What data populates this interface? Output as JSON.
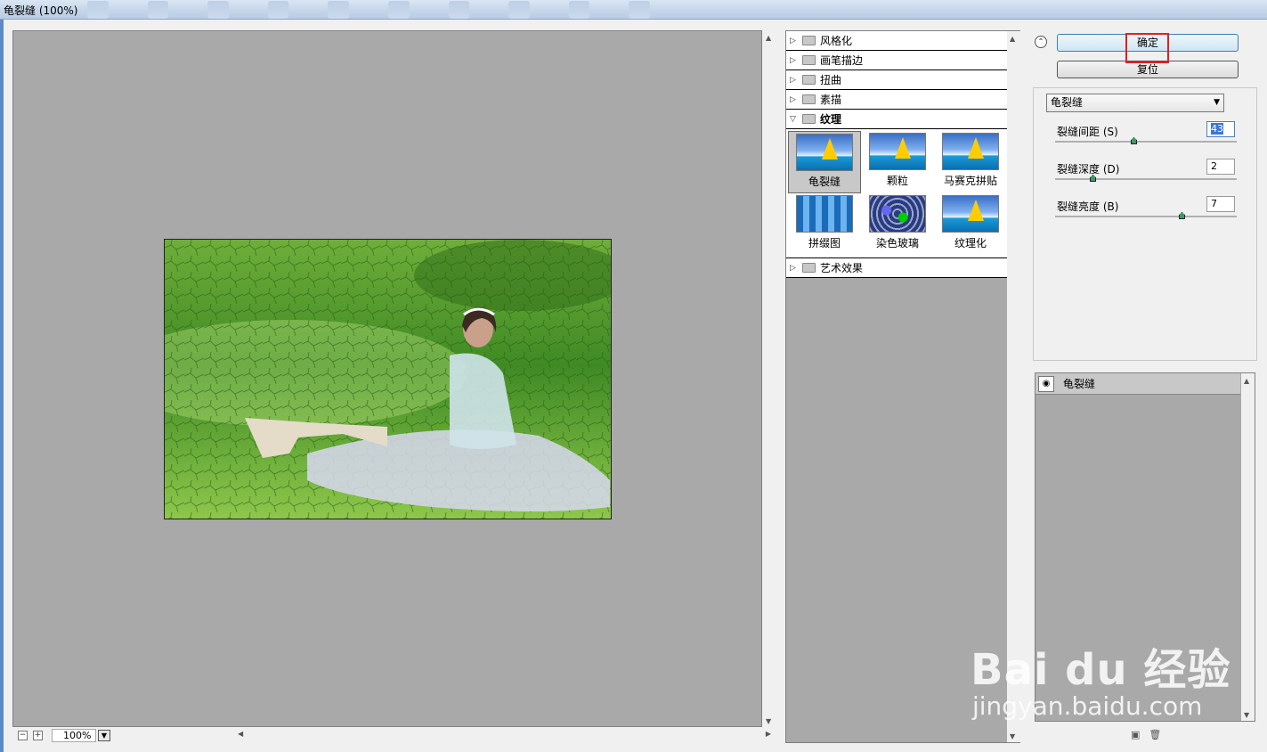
{
  "window": {
    "title": "龟裂缝 (100%)"
  },
  "preview": {
    "zoom": "100%"
  },
  "categories": [
    {
      "label": "风格化",
      "open": false
    },
    {
      "label": "画笔描边",
      "open": false
    },
    {
      "label": "扭曲",
      "open": false
    },
    {
      "label": "素描",
      "open": false
    },
    {
      "label": "纹理",
      "open": true
    },
    {
      "label": "艺术效果",
      "open": false
    }
  ],
  "texture_filters": [
    "龟裂缝",
    "颗粒",
    "马赛克拼贴",
    "拼缀图",
    "染色玻璃",
    "纹理化"
  ],
  "buttons": {
    "ok": "确定",
    "reset": "复位"
  },
  "settings": {
    "filter_select": "龟裂缝",
    "params": [
      {
        "label": "裂缝间距 (S)",
        "value": "43",
        "level": 0.43
      },
      {
        "label": "裂缝深度 (D)",
        "value": "2",
        "level": 0.2
      },
      {
        "label": "裂缝亮度 (B)",
        "value": "7",
        "level": 0.7
      }
    ]
  },
  "layers": [
    {
      "name": "龟裂缝"
    }
  ],
  "watermark": {
    "brand": "Bai du 经验",
    "url": "jingyan.baidu.com"
  },
  "colors": {
    "accent": "#3c7fb1",
    "highlight": "#e02020",
    "canvas": "#a9a9a9"
  }
}
